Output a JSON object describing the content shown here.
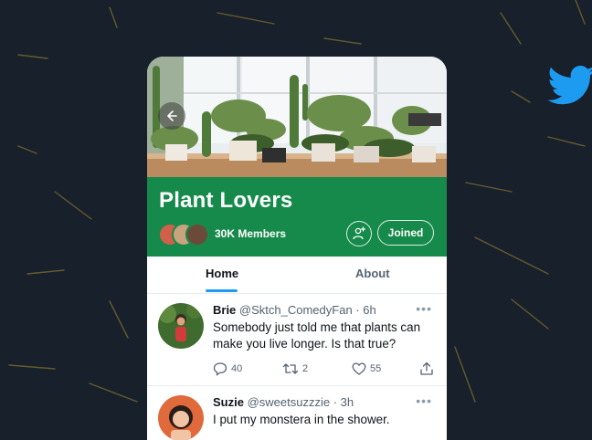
{
  "group": {
    "name": "Plant Lovers",
    "members": "30K Members",
    "joined_label": "Joined"
  },
  "tabs": [
    {
      "label": "Home",
      "active": true
    },
    {
      "label": "About",
      "active": false
    }
  ],
  "tweets": [
    {
      "name": "Brie",
      "handle": "@Sktch_ComedyFan",
      "time": "· 6h",
      "text": "Somebody just told me that plants can make you live longer. Is that true?",
      "replies": "40",
      "retweets": "2",
      "likes": "55"
    },
    {
      "name": "Suzie",
      "handle": "@sweetsuzzzie",
      "time": "· 3h",
      "text": "I put my monstera in the shower."
    }
  ],
  "colors": {
    "background": "#17202b",
    "header_green": "#168a4a",
    "twitter_blue": "#1d9bf0"
  },
  "icons": [
    "back-arrow-icon",
    "add-member-icon",
    "reply-icon",
    "retweet-icon",
    "like-icon",
    "share-icon",
    "more-icon",
    "twitter-bird-icon"
  ]
}
